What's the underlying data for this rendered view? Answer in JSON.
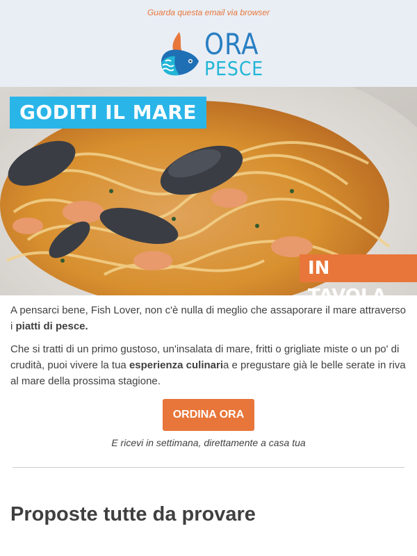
{
  "header": {
    "view_in_browser": "Guarda questa email via browser",
    "logo_line1": "ORA",
    "logo_line2": "PESCE"
  },
  "hero": {
    "banner_top": "GODITI IL MARE",
    "banner_bottom": "IN TAVOLA",
    "image": "pasta-with-seafood"
  },
  "body": {
    "p1_before": "A pensarci bene, Fish Lover, non c'è nulla di meglio che assaporare il mare attraverso i ",
    "p1_bold": "piatti di pesce.",
    "p2_before": "Che si tratti di un primo gustoso, un'insalata di mare, fritti o grigliate miste o un po' di crudità, puoi vivere la tua ",
    "p2_bold": "esperienza culinari",
    "p2_after": "a e pregustare già le belle serate in riva al mare della prossima stagione.",
    "cta_label": "ORDINA ORA",
    "cta_note": "E ricevi in settimana, direttamente a casa tua"
  },
  "section": {
    "title": "Proposte tutte da provare"
  },
  "colors": {
    "accent_orange": "#e8763a",
    "accent_blue": "#2ab5e8",
    "header_bg": "#e9eef5"
  }
}
